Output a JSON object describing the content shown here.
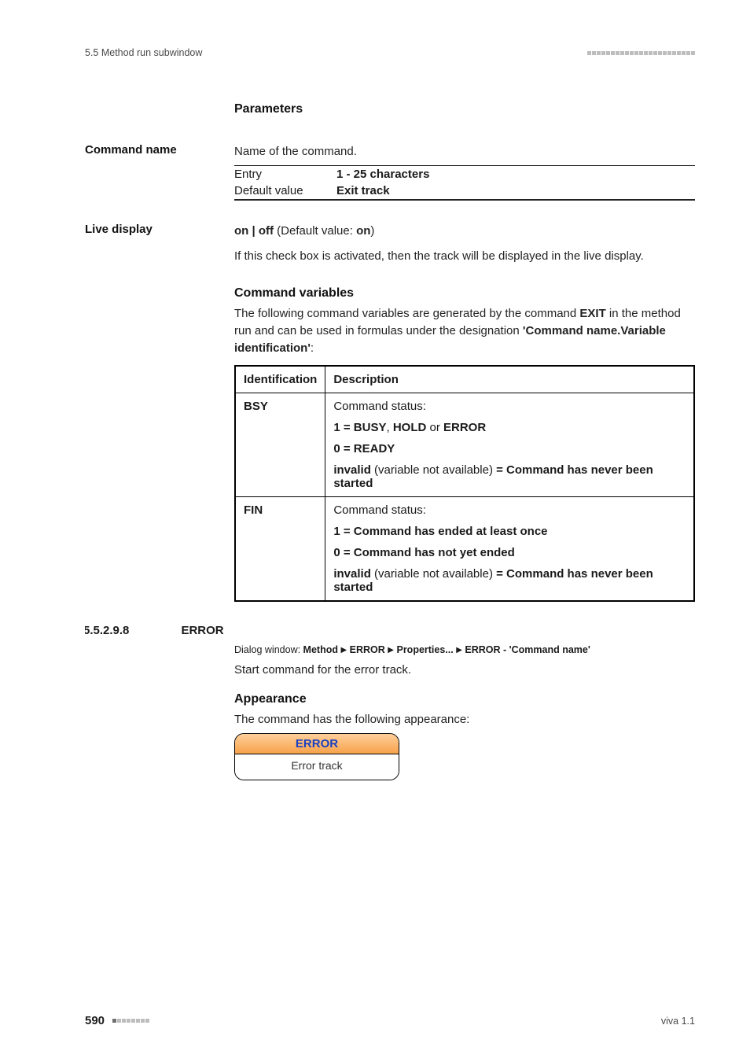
{
  "header": {
    "section_ref": "5.5 Method run subwindow"
  },
  "footer": {
    "page_number": "590",
    "version": "viva 1.1"
  },
  "parameters": {
    "heading": "Parameters",
    "command_name": {
      "label": "Command name",
      "desc": "Name of the command.",
      "entry_label": "Entry",
      "entry_value": "1 - 25 characters",
      "default_label": "Default value",
      "default_value": "Exit track"
    },
    "live_display": {
      "label": "Live display",
      "options_pre": "on | off",
      "default_paren_label": " (Default value: ",
      "default_value": "on",
      "default_paren_close": ")",
      "desc": "If this check box is activated, then the track will be displayed in the live display."
    }
  },
  "command_variables": {
    "heading": "Command variables",
    "intro_pre": "The following command variables are generated by the command ",
    "intro_cmd": "EXIT",
    "intro_mid": " in the method run and can be used in formulas under the designation ",
    "intro_bold": "'Command name.Variable identification'",
    "intro_end": ":",
    "table": {
      "col_id": "Identification",
      "col_desc": "Description",
      "rows": [
        {
          "id": "BSY",
          "status_label": "Command status:",
          "one_pre": "1 = BUSY",
          "one_mid": ", ",
          "one_mid2": "HOLD",
          "one_or": " or ",
          "one_end": "ERROR",
          "zero": "0 = READY",
          "invalid_pre": "invalid",
          "invalid_mid": " (variable not available) ",
          "invalid_post": "= Command has never been started"
        },
        {
          "id": "FIN",
          "status_label": "Command status:",
          "one": "1 = Command has ended at least once",
          "zero": "0 = Command has not yet ended",
          "invalid_pre": "invalid",
          "invalid_mid": " (variable not available) ",
          "invalid_post": "= Command has never been started"
        }
      ]
    }
  },
  "error_section": {
    "number": "5.5.2.9.8",
    "title": "ERROR",
    "dialog_label": "Dialog window: ",
    "dialog_parts": [
      "Method",
      "ERROR",
      "Properties...",
      "ERROR - 'Command name'"
    ],
    "intro": "Start command for the error track.",
    "appearance_heading": "Appearance",
    "appearance_desc": "The command has the following appearance:",
    "block_top": "ERROR",
    "block_bottom": "Error track"
  }
}
